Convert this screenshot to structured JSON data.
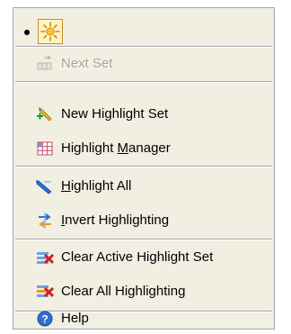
{
  "menu": {
    "items": [
      {
        "label": "Next Set",
        "icon": "next-set-icon",
        "disabled": true
      },
      {
        "label": "New Highlight Set",
        "icon": "new-highlight-set-icon"
      },
      {
        "label_pre": "Highlight ",
        "label_mnemonic": "M",
        "label_post": "anager",
        "icon": "highlight-manager-icon"
      },
      {
        "label_pre": "",
        "label_mnemonic": "H",
        "label_post": "ighlight All",
        "icon": "highlight-all-icon"
      },
      {
        "label_pre": "",
        "label_mnemonic": "I",
        "label_post": "nvert Highlighting",
        "icon": "invert-highlighting-icon"
      },
      {
        "label": "Clear Active Highlight Set",
        "icon": "clear-active-highlight-set-icon"
      },
      {
        "label": "Clear All Highlighting",
        "icon": "clear-all-highlighting-icon"
      },
      {
        "label": "Help",
        "icon": "help-icon"
      }
    ]
  },
  "colors": {
    "menu_background": "#f1efe2",
    "border": "#a7a6aa",
    "disabled_text": "#a4a39a",
    "sun_icon_box": "#fff3c4",
    "sun_icon_border": "#c98b2a",
    "clear_x_red": "#d21f1f",
    "help_blue": "#2d6fd1"
  }
}
